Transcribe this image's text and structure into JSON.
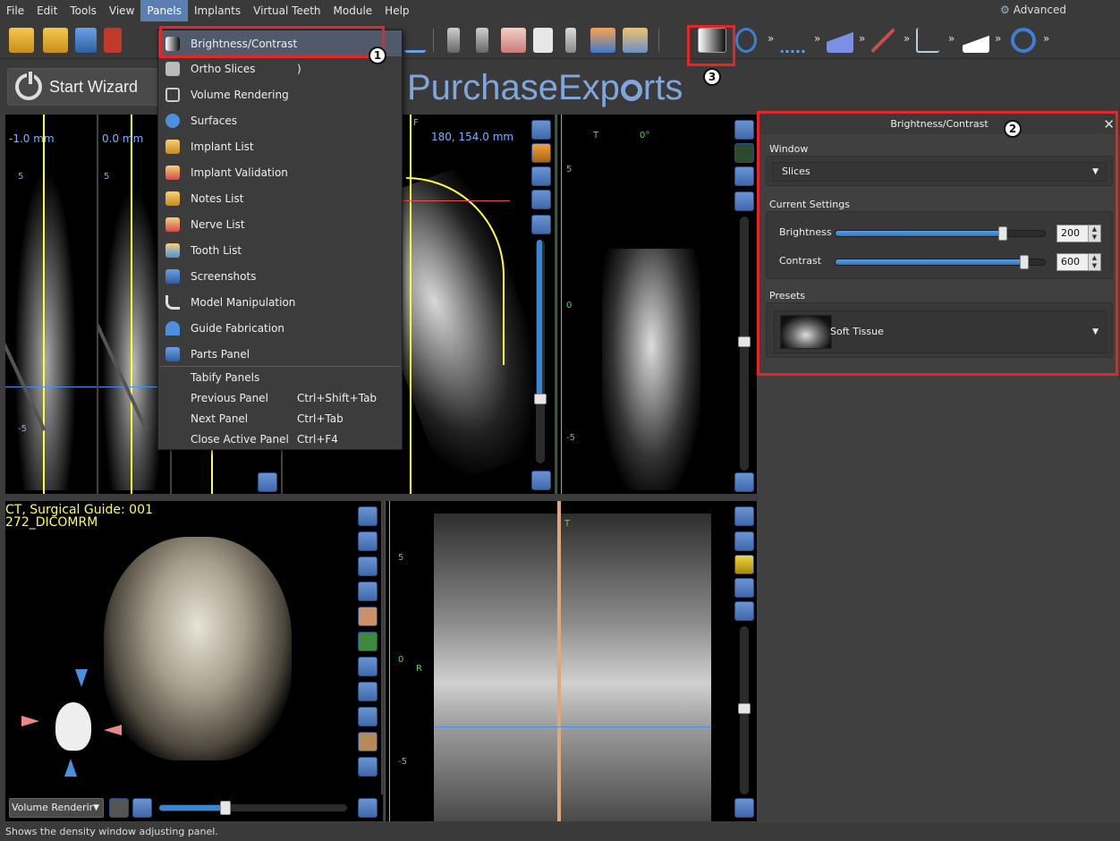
{
  "menubar": {
    "items": [
      "File",
      "Edit",
      "Tools",
      "View",
      "Panels",
      "Implants",
      "Virtual Teeth",
      "Module",
      "Help"
    ],
    "advanced": "Advanced"
  },
  "wizard": {
    "label": "Start Wizard"
  },
  "brand": {
    "left": "Purchase",
    "right": "Exp",
    "tail": "rts"
  },
  "menu": {
    "items": [
      {
        "label": "Brightness/Contrast",
        "icon": "brightness-icon"
      },
      {
        "label": "Ortho Slices",
        "icon": "ortho-slices-icon"
      },
      {
        "label": "Volume Rendering",
        "icon": "volume-rendering-icon"
      },
      {
        "label": "Surfaces",
        "icon": "surfaces-icon"
      },
      {
        "label": "Implant List",
        "icon": "implant-list-icon"
      },
      {
        "label": "Implant Validation",
        "icon": "implant-validation-icon"
      },
      {
        "label": "Notes List",
        "icon": "notes-list-icon"
      },
      {
        "label": "Nerve List",
        "icon": "nerve-list-icon"
      },
      {
        "label": "Tooth List",
        "icon": "tooth-list-icon"
      },
      {
        "label": "Screenshots",
        "icon": "screenshots-icon"
      },
      {
        "label": "Model Manipulation",
        "icon": "model-manipulation-icon"
      },
      {
        "label": "Guide Fabrication",
        "icon": "guide-fabrication-icon"
      },
      {
        "label": "Parts Panel",
        "icon": "parts-panel-icon"
      }
    ],
    "commands": [
      {
        "label": "Tabify Panels",
        "shortcut": ""
      },
      {
        "label": "Previous Panel",
        "shortcut": "Ctrl+Shift+Tab"
      },
      {
        "label": "Next Panel",
        "shortcut": "Ctrl+Tab"
      },
      {
        "label": "Close Active Panel",
        "shortcut": "Ctrl+F4"
      }
    ],
    "ortho_suffix": ")"
  },
  "viewports": {
    "slice1_label": "-1.0 mm",
    "slice2_label": "0.0 mm",
    "axial_label": "180, 154.0 mm",
    "axial_corner": "F",
    "coronal_t": "T",
    "coronal_angle": "0°",
    "tick_5": "5",
    "tick_0": "0",
    "tick_m5": "-5",
    "vr_title1": "CT, Surgical Guide: 001",
    "vr_title2": "272_DICOMRM",
    "pano_t": "T",
    "pano_r": "R",
    "vr_combo": "Volume Renderir"
  },
  "panel": {
    "title": "Brightness/Contrast",
    "window_label": "Window",
    "window_value": "Slices",
    "current_settings_label": "Current Settings",
    "brightness_label": "Brightness",
    "brightness_value": "200",
    "brightness_fraction": 0.8,
    "contrast_label": "Contrast",
    "contrast_value": "600",
    "contrast_fraction": 0.9,
    "presets_label": "Presets",
    "preset_value": "Soft Tissue"
  },
  "badges": {
    "one": "1",
    "two": "2",
    "three": "3"
  },
  "status": "Shows the density window adjusting panel.",
  "colors": {
    "accent": "#e8242b",
    "slider": "#3a86d6",
    "brand": "#7fa7dd"
  }
}
